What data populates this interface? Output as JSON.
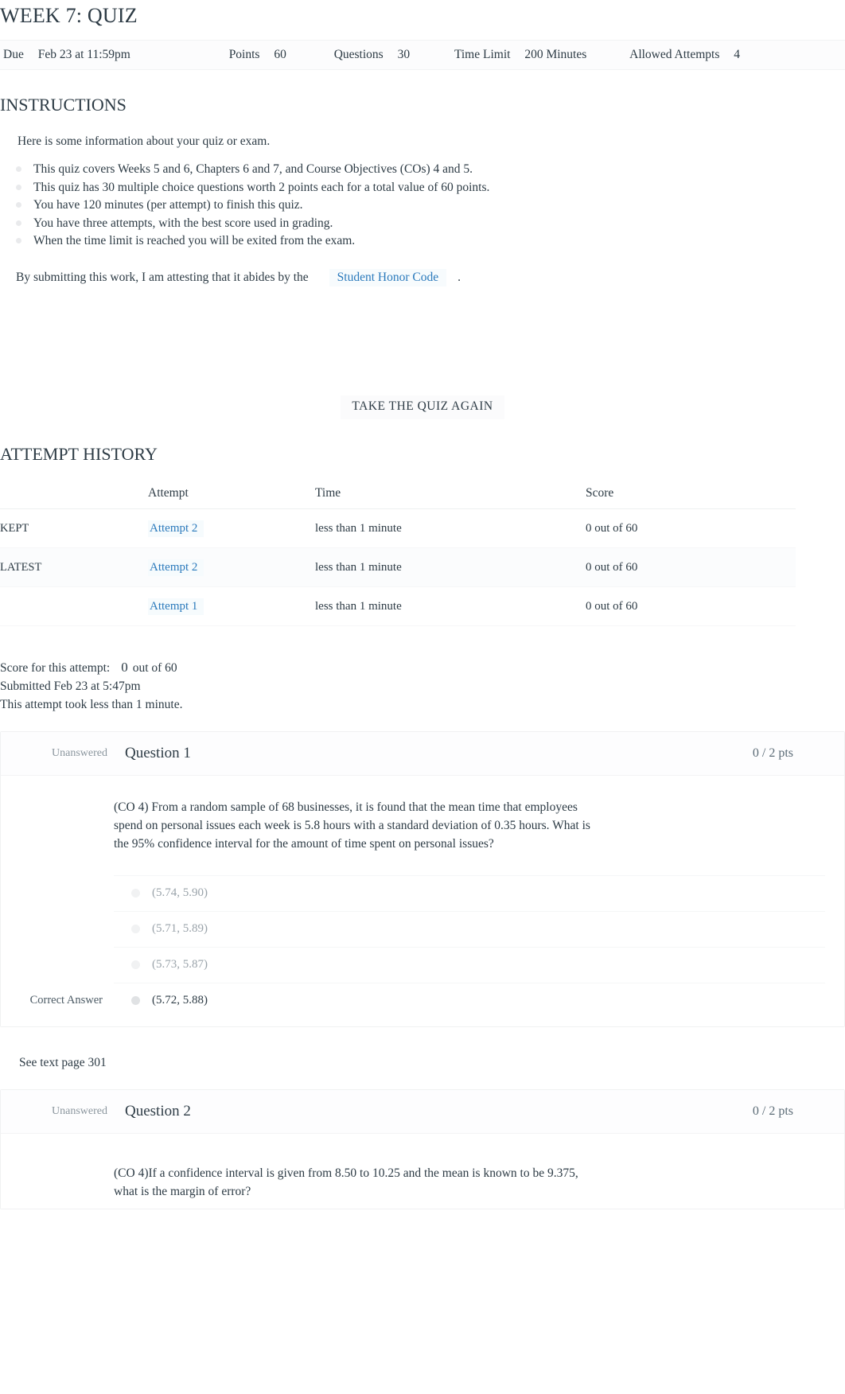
{
  "quiz": {
    "title": "WEEK 7: QUIZ",
    "meta": {
      "due_label": "Due",
      "due_value": "Feb 23 at 11:59pm",
      "points_label": "Points",
      "points_value": "60",
      "questions_label": "Questions",
      "questions_value": "30",
      "time_limit_label": "Time Limit",
      "time_limit_value": "200 Minutes",
      "allowed_attempts_label": "Allowed Attempts",
      "allowed_attempts_value": "4"
    }
  },
  "instructions": {
    "heading": "INSTRUCTIONS",
    "intro": "Here is some information about your quiz or exam.",
    "bullets": [
      "This quiz covers Weeks 5 and 6, Chapters 6 and 7, and Course Objectives (COs) 4 and 5.",
      "This quiz has 30 multiple choice questions worth 2 points each for a total value of 60 points.",
      "You have 120 minutes (per attempt) to finish this quiz.",
      "You have three attempts, with the best score used in grading.",
      "When the time limit is reached you will be exited from the exam."
    ],
    "honor_prefix": "By submitting this work, I am attesting that it abides by the",
    "honor_link": "Student Honor Code",
    "honor_suffix": "."
  },
  "actions": {
    "take_again": "TAKE THE QUIZ AGAIN"
  },
  "attempt_history": {
    "heading": "ATTEMPT HISTORY",
    "columns": {
      "blank": "",
      "attempt": "Attempt",
      "time": "Time",
      "score": "Score"
    },
    "rows": [
      {
        "flag": "KEPT",
        "attempt": "Attempt 2",
        "time": "less than 1 minute",
        "score": "0 out of 60"
      },
      {
        "flag": "LATEST",
        "attempt": "Attempt 2",
        "time": "less than 1 minute",
        "score": "0 out of 60"
      },
      {
        "flag": "",
        "attempt": "Attempt 1",
        "time": "less than 1 minute",
        "score": "0 out of 60"
      }
    ]
  },
  "score_summary": {
    "score_label": "Score for this attempt:",
    "score_value": "0",
    "score_suffix": "out of 60",
    "submitted": "Submitted Feb 23 at 5:47pm",
    "duration": "This attempt took less than 1 minute."
  },
  "questions": [
    {
      "status": "Unanswered",
      "name": "Question 1",
      "points": "0 / 2 pts",
      "text": "(CO 4) From a random sample of 68 businesses, it is found that the mean time that employees spend on personal issues each week is 5.8 hours with a standard deviation of 0.35 hours. What is the 95% confidence interval for the amount of time spent on personal issues?",
      "answers": [
        {
          "text": "(5.74, 5.90)",
          "correct": false,
          "tag": ""
        },
        {
          "text": "(5.71, 5.89)",
          "correct": false,
          "tag": ""
        },
        {
          "text": "(5.73, 5.87)",
          "correct": false,
          "tag": ""
        },
        {
          "text": "(5.72, 5.88)",
          "correct": true,
          "tag": "Correct Answer"
        }
      ],
      "note": "See text page 301"
    },
    {
      "status": "Unanswered",
      "name": "Question 2",
      "points": "0 / 2 pts",
      "text": "(CO 4)If a confidence interval is given from 8.50 to 10.25 and the mean is known to be 9.375, what is the margin of error?",
      "answers": [],
      "note": ""
    }
  ],
  "colors": {
    "link": "#2b7abc",
    "text": "#2d3b45",
    "muted": "#8b969e"
  }
}
